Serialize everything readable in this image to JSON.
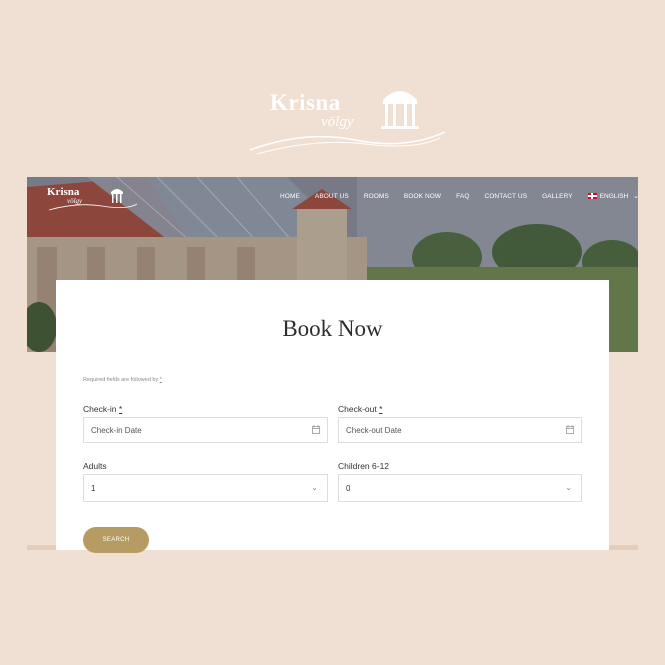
{
  "brand": {
    "name": "Krisna",
    "subtitle": "völgy"
  },
  "nav": {
    "items": [
      "HOME",
      "ABOUT US",
      "ROOMS",
      "BOOK NOW",
      "FAQ",
      "CONTACT US",
      "GALLERY"
    ],
    "language": "ENGLISH"
  },
  "page": {
    "title": "Book Now",
    "required_note": "Required fields are followed by",
    "required_star": "*"
  },
  "form": {
    "checkin": {
      "label": "Check-in",
      "placeholder": "Check-in Date"
    },
    "checkout": {
      "label": "Check-out",
      "placeholder": "Check-out Date"
    },
    "adults": {
      "label": "Adults",
      "value": "1"
    },
    "children": {
      "label": "Children 6-12",
      "value": "0"
    },
    "search_label": "SEARCH"
  },
  "colors": {
    "background": "#f0e0d3",
    "accent": "#b69c62",
    "card": "#ffffff"
  },
  "icons": {
    "calendar": "calendar-icon",
    "dropdown": "chevron-down-icon"
  }
}
